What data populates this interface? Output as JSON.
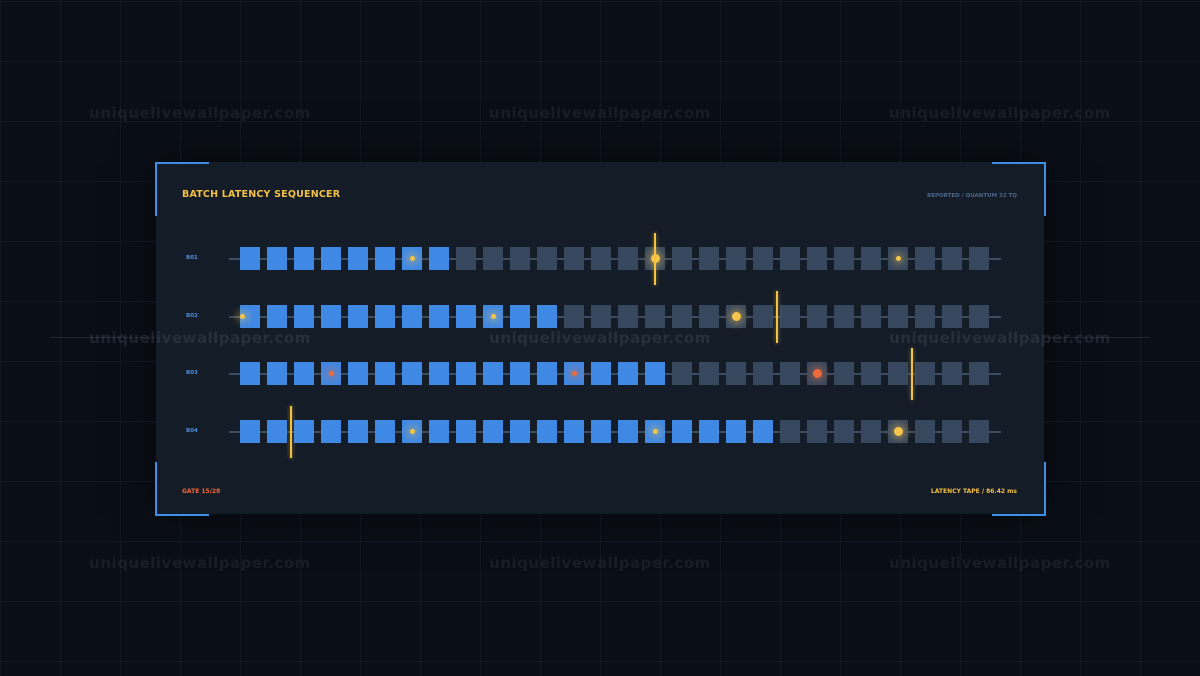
{
  "watermark": "uniquelivewallpaper.com",
  "panel": {
    "title": "BATCH LATENCY SEQUENCER",
    "subtitle": "REPORTED / QUANTUM 32 TQ",
    "gate": "GATE 15/28",
    "latency_tape": "LATENCY TAPE / 86.42 ms"
  },
  "colors": {
    "accent": "#f4c042",
    "active": "#3f88e4",
    "idle": "#36475e",
    "alert": "#ef6a3a",
    "frame": "#3d8fe6"
  },
  "cells_per_row": 28,
  "rows": [
    {
      "label": "B01",
      "filled": 8,
      "marker_cell": 15,
      "dots": [
        {
          "cell": 6,
          "color": "yellow",
          "size": "small"
        },
        {
          "cell": 15,
          "color": "yellow",
          "size": "medium"
        },
        {
          "cell": 24,
          "color": "yellow",
          "size": "small"
        }
      ]
    },
    {
      "label": "B02",
      "filled": 12,
      "marker_cell": 19.5,
      "dots": [
        {
          "cell": 0,
          "color": "yellow",
          "size": "small"
        },
        {
          "cell": 9,
          "color": "yellow",
          "size": "small"
        },
        {
          "cell": 18,
          "color": "yellow",
          "size": "medium"
        }
      ]
    },
    {
      "label": "B03",
      "filled": 16,
      "marker_cell": 24.5,
      "dots": [
        {
          "cell": 3,
          "color": "red",
          "size": "small"
        },
        {
          "cell": 12,
          "color": "red",
          "size": "small"
        },
        {
          "cell": 21,
          "color": "red",
          "size": "medium"
        }
      ]
    },
    {
      "label": "B04",
      "filled": 20,
      "marker_cell": 1.5,
      "dots": [
        {
          "cell": 6,
          "color": "yellow",
          "size": "small"
        },
        {
          "cell": 15,
          "color": "yellow",
          "size": "small"
        },
        {
          "cell": 24,
          "color": "yellow",
          "size": "medium"
        }
      ]
    }
  ]
}
